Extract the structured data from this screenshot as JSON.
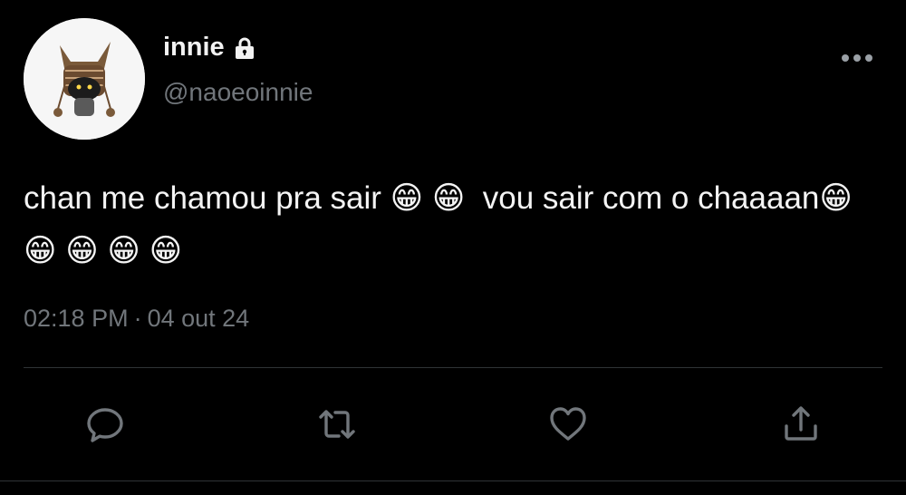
{
  "tweet": {
    "author": {
      "display_name": "innie",
      "handle": "@naoeoinnie",
      "avatar_icon": "cat-avatar-icon",
      "protected_icon": "lock-icon"
    },
    "text": "chan me chamou pra sair 😁 😁  vou sair com o chaaaan😁 😁 😁 😁 😁",
    "time": "02:18 PM",
    "separator": "·",
    "date": "04 out 24"
  },
  "actions": [
    {
      "name": "reply",
      "icon": "speech-bubble-icon"
    },
    {
      "name": "retweet",
      "icon": "retweet-icon"
    },
    {
      "name": "like",
      "icon": "heart-icon"
    },
    {
      "name": "share",
      "icon": "share-icon"
    }
  ],
  "colors": {
    "background": "#000000",
    "text": "#e7e9ea",
    "secondary": "#71767b",
    "divider": "#2f3336"
  }
}
